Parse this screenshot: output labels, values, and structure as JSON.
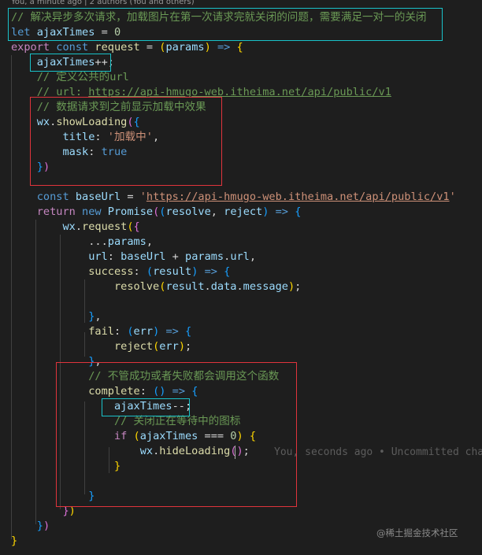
{
  "codelens": "You, a minute ago | 2 authors (You and others)",
  "blame": "You, seconds ago • Uncommitted cha",
  "watermark": "@稀土掘金技术社区",
  "lines": [
    [
      [
        "com",
        "// 解决异步多次请求，加载图片在第一次请求完就关闭的问题，需要满足一对一的关闭"
      ]
    ],
    [
      [
        "kw",
        "let"
      ],
      [
        "pl",
        " "
      ],
      [
        "var",
        "ajaxTimes"
      ],
      [
        "pl",
        " = "
      ],
      [
        "num",
        "0"
      ]
    ],
    [
      [
        "ctl",
        "export"
      ],
      [
        "pl",
        " "
      ],
      [
        "kw",
        "const"
      ],
      [
        "pl",
        " "
      ],
      [
        "fn",
        "request"
      ],
      [
        "pl",
        " = "
      ],
      [
        "b1",
        "("
      ],
      [
        "var",
        "params"
      ],
      [
        "b1",
        ")"
      ],
      [
        "pl",
        " "
      ],
      [
        "kw",
        "=>"
      ],
      [
        "pl",
        " "
      ],
      [
        "b1",
        "{"
      ]
    ],
    [
      [
        "pl",
        "    "
      ],
      [
        "var",
        "ajaxTimes"
      ],
      [
        "pl",
        "++;"
      ]
    ],
    [
      [
        "pl",
        "    "
      ],
      [
        "com",
        "// 定义公共的url"
      ]
    ],
    [
      [
        "pl",
        "    "
      ],
      [
        "com",
        "// url: "
      ],
      [
        "curl",
        "https://api-hmugo-web.itheima.net/api/public/v1"
      ]
    ],
    [
      [
        "pl",
        "    "
      ],
      [
        "com",
        "// 数据请求到之前显示加载中效果"
      ]
    ],
    [
      [
        "pl",
        "    "
      ],
      [
        "var",
        "wx"
      ],
      [
        "pl",
        "."
      ],
      [
        "fn",
        "showLoading"
      ],
      [
        "b2",
        "("
      ],
      [
        "b3",
        "{"
      ]
    ],
    [
      [
        "pl",
        "        "
      ],
      [
        "var",
        "title"
      ],
      [
        "pl",
        ": "
      ],
      [
        "str",
        "'加载中'"
      ],
      [
        "pl",
        ","
      ]
    ],
    [
      [
        "pl",
        "        "
      ],
      [
        "var",
        "mask"
      ],
      [
        "pl",
        ": "
      ],
      [
        "kw",
        "true"
      ]
    ],
    [
      [
        "pl",
        "    "
      ],
      [
        "b3",
        "}"
      ],
      [
        "b2",
        ")"
      ]
    ],
    [
      [
        "pl",
        ""
      ]
    ],
    [
      [
        "pl",
        "    "
      ],
      [
        "kw",
        "const"
      ],
      [
        "pl",
        " "
      ],
      [
        "var",
        "baseUrl"
      ],
      [
        "pl",
        " = "
      ],
      [
        "str",
        "'"
      ],
      [
        "url",
        "https://api-hmugo-web.itheima.net/api/public/v1"
      ],
      [
        "str",
        "'"
      ]
    ],
    [
      [
        "pl",
        "    "
      ],
      [
        "ctl",
        "return"
      ],
      [
        "pl",
        " "
      ],
      [
        "kw",
        "new"
      ],
      [
        "pl",
        " "
      ],
      [
        "var",
        "Promise"
      ],
      [
        "b2",
        "("
      ],
      [
        "b3",
        "("
      ],
      [
        "var",
        "resolve"
      ],
      [
        "pl",
        ", "
      ],
      [
        "var",
        "reject"
      ],
      [
        "b3",
        ")"
      ],
      [
        "pl",
        " "
      ],
      [
        "kw",
        "=>"
      ],
      [
        "pl",
        " "
      ],
      [
        "b3",
        "{"
      ]
    ],
    [
      [
        "pl",
        "        "
      ],
      [
        "var",
        "wx"
      ],
      [
        "pl",
        "."
      ],
      [
        "fn",
        "request"
      ],
      [
        "b1",
        "("
      ],
      [
        "b2",
        "{"
      ]
    ],
    [
      [
        "pl",
        "            ..."
      ],
      [
        "var",
        "params"
      ],
      [
        "pl",
        ","
      ]
    ],
    [
      [
        "pl",
        "            "
      ],
      [
        "var",
        "url"
      ],
      [
        "pl",
        ": "
      ],
      [
        "var",
        "baseUrl"
      ],
      [
        "pl",
        " + "
      ],
      [
        "var",
        "params"
      ],
      [
        "pl",
        "."
      ],
      [
        "var",
        "url"
      ],
      [
        "pl",
        ","
      ]
    ],
    [
      [
        "pl",
        "            "
      ],
      [
        "fn",
        "success"
      ],
      [
        "pl",
        ": "
      ],
      [
        "b3",
        "("
      ],
      [
        "var",
        "result"
      ],
      [
        "b3",
        ")"
      ],
      [
        "pl",
        " "
      ],
      [
        "kw",
        "=>"
      ],
      [
        "pl",
        " "
      ],
      [
        "b3",
        "{"
      ]
    ],
    [
      [
        "pl",
        "                "
      ],
      [
        "fn",
        "resolve"
      ],
      [
        "b1",
        "("
      ],
      [
        "var",
        "result"
      ],
      [
        "pl",
        "."
      ],
      [
        "var",
        "data"
      ],
      [
        "pl",
        "."
      ],
      [
        "var",
        "message"
      ],
      [
        "b1",
        ")"
      ],
      [
        "pl",
        ";"
      ]
    ],
    [
      [
        "pl",
        ""
      ]
    ],
    [
      [
        "pl",
        "            "
      ],
      [
        "b3",
        "}"
      ],
      [
        "pl",
        ","
      ]
    ],
    [
      [
        "pl",
        "            "
      ],
      [
        "fn",
        "fail"
      ],
      [
        "pl",
        ": "
      ],
      [
        "b3",
        "("
      ],
      [
        "var",
        "err"
      ],
      [
        "b3",
        ")"
      ],
      [
        "pl",
        " "
      ],
      [
        "kw",
        "=>"
      ],
      [
        "pl",
        " "
      ],
      [
        "b3",
        "{"
      ]
    ],
    [
      [
        "pl",
        "                "
      ],
      [
        "fn",
        "reject"
      ],
      [
        "b1",
        "("
      ],
      [
        "var",
        "err"
      ],
      [
        "b1",
        ")"
      ],
      [
        "pl",
        ";"
      ]
    ],
    [
      [
        "pl",
        "            "
      ],
      [
        "b3",
        "}"
      ],
      [
        "pl",
        ","
      ]
    ],
    [
      [
        "pl",
        "            "
      ],
      [
        "com",
        "// 不管成功或者失败都会调用这个函数"
      ]
    ],
    [
      [
        "pl",
        "            "
      ],
      [
        "fn",
        "complete"
      ],
      [
        "pl",
        ": "
      ],
      [
        "b3",
        "("
      ],
      [
        "b3",
        ")"
      ],
      [
        "pl",
        " "
      ],
      [
        "kw",
        "=>"
      ],
      [
        "pl",
        " "
      ],
      [
        "b3",
        "{"
      ]
    ],
    [
      [
        "pl",
        "                "
      ],
      [
        "var",
        "ajaxTimes"
      ],
      [
        "pl",
        "--;"
      ]
    ],
    [
      [
        "pl",
        "                "
      ],
      [
        "com",
        "// 关闭正在等待中的图标"
      ]
    ],
    [
      [
        "pl",
        "                "
      ],
      [
        "ctl",
        "if"
      ],
      [
        "pl",
        " "
      ],
      [
        "b1",
        "("
      ],
      [
        "var",
        "ajaxTimes"
      ],
      [
        "pl",
        " === "
      ],
      [
        "num",
        "0"
      ],
      [
        "b1",
        ")"
      ],
      [
        "pl",
        " "
      ],
      [
        "b1",
        "{"
      ]
    ],
    [
      [
        "pl",
        "                    "
      ],
      [
        "var",
        "wx"
      ],
      [
        "pl",
        "."
      ],
      [
        "fn",
        "hideLoading"
      ],
      [
        "b2",
        "("
      ],
      [
        "b2",
        ")"
      ],
      [
        "pl",
        ";"
      ]
    ],
    [
      [
        "pl",
        "                "
      ],
      [
        "b1",
        "}"
      ]
    ],
    [
      [
        "pl",
        ""
      ]
    ],
    [
      [
        "pl",
        "            "
      ],
      [
        "b3",
        "}"
      ]
    ],
    [
      [
        "pl",
        "        "
      ],
      [
        "b2",
        "}"
      ],
      [
        "b1",
        ")"
      ]
    ],
    [
      [
        "pl",
        "    "
      ],
      [
        "b3",
        "}"
      ],
      [
        "b2",
        ")"
      ]
    ],
    [
      [
        "b1",
        "}"
      ]
    ]
  ]
}
